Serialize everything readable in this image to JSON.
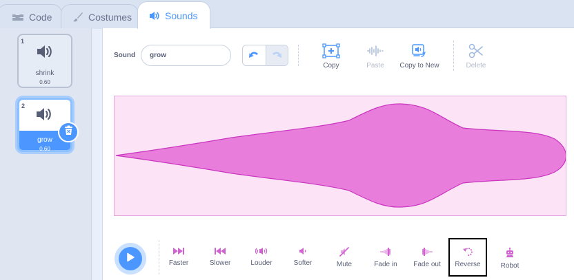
{
  "tabs": [
    {
      "label": "Code",
      "icon": "code-icon"
    },
    {
      "label": "Costumes",
      "icon": "brush-icon"
    },
    {
      "label": "Sounds",
      "icon": "speaker-icon"
    }
  ],
  "sounds": [
    {
      "number": "1",
      "name": "shrink",
      "size": "0.60",
      "icon": "speaker-icon"
    },
    {
      "number": "2",
      "name": "grow",
      "size": "0.60",
      "icon": "speaker-icon",
      "selected": true
    }
  ],
  "editor": {
    "sound_label": "Sound",
    "sound_name": "grow",
    "tools": {
      "copy": "Copy",
      "paste": "Paste",
      "copy_to_new": "Copy to New",
      "delete": "Delete"
    }
  },
  "effects": [
    {
      "label": "Faster",
      "icon": "faster-icon"
    },
    {
      "label": "Slower",
      "icon": "slower-icon"
    },
    {
      "label": "Louder",
      "icon": "louder-icon"
    },
    {
      "label": "Softer",
      "icon": "softer-icon"
    },
    {
      "label": "Mute",
      "icon": "mute-icon"
    },
    {
      "label": "Fade in",
      "icon": "fade-in-icon"
    },
    {
      "label": "Fade out",
      "icon": "fade-out-icon"
    },
    {
      "label": "Reverse",
      "icon": "reverse-icon",
      "highlighted": true
    },
    {
      "label": "Robot",
      "icon": "robot-icon"
    }
  ],
  "colors": {
    "accent": "#4c97ff",
    "sound_effect": "#cf63cf",
    "waveform_fill": "#e97ddb",
    "waveform_background": "#fce4f6"
  }
}
